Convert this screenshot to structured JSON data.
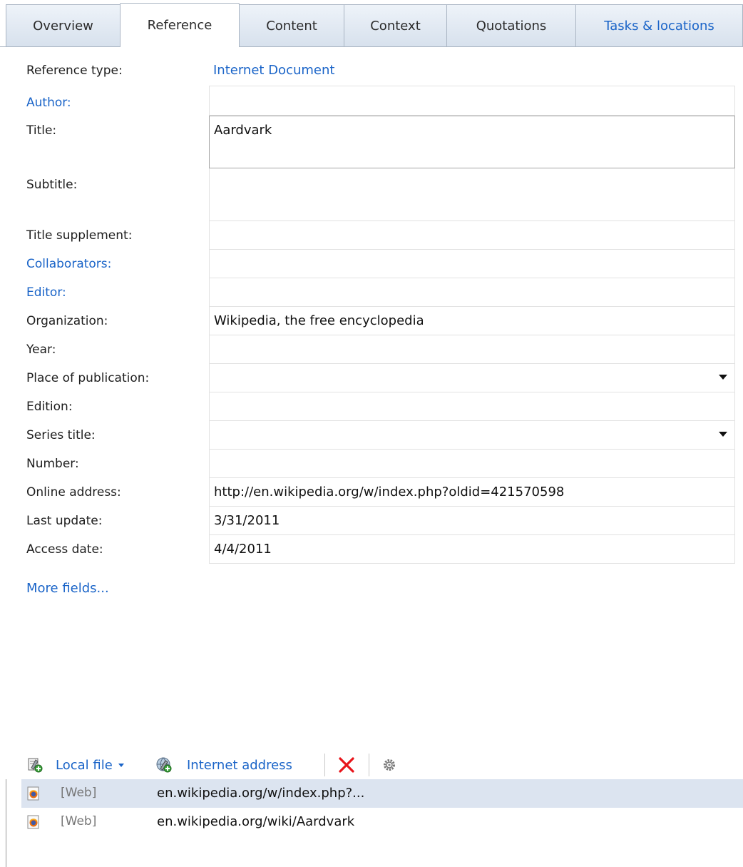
{
  "tabs": [
    {
      "label": "Overview"
    },
    {
      "label": "Reference"
    },
    {
      "label": "Content"
    },
    {
      "label": "Context"
    },
    {
      "label": "Quotations"
    },
    {
      "label": "Tasks & locations"
    }
  ],
  "reference_type": {
    "label": "Reference type:",
    "value": "Internet Document"
  },
  "fields": {
    "author": {
      "label": "Author:",
      "value": ""
    },
    "title": {
      "label": "Title:",
      "value": "Aardvark"
    },
    "subtitle": {
      "label": "Subtitle:",
      "value": ""
    },
    "title_supplement": {
      "label": "Title supplement:",
      "value": ""
    },
    "collaborators": {
      "label": "Collaborators:",
      "value": ""
    },
    "editor": {
      "label": "Editor:",
      "value": ""
    },
    "organization": {
      "label": "Organization:",
      "value": "Wikipedia, the free encyclopedia"
    },
    "year": {
      "label": "Year:",
      "value": ""
    },
    "place_of_publication": {
      "label": "Place of publication:",
      "value": ""
    },
    "edition": {
      "label": "Edition:",
      "value": ""
    },
    "series_title": {
      "label": "Series title:",
      "value": ""
    },
    "number": {
      "label": "Number:",
      "value": ""
    },
    "online_address": {
      "label": "Online address:",
      "value": "http://en.wikipedia.org/w/index.php?oldid=421570598"
    },
    "last_update": {
      "label": "Last update:",
      "value": "3/31/2011"
    },
    "access_date": {
      "label": "Access date:",
      "value": "4/4/2011"
    }
  },
  "more_fields": "More fields...",
  "toolbar": {
    "local_file": "Local file",
    "internet_address": "Internet address"
  },
  "files": [
    {
      "tag": "[Web]",
      "address": "en.wikipedia.org/w/index.php?...",
      "selected": true
    },
    {
      "tag": "[Web]",
      "address": "en.wikipedia.org/wiki/Aardvark",
      "selected": false
    }
  ],
  "colors": {
    "link": "#1a64c8",
    "selection": "#dce4f0",
    "delete": "#e8141a"
  }
}
